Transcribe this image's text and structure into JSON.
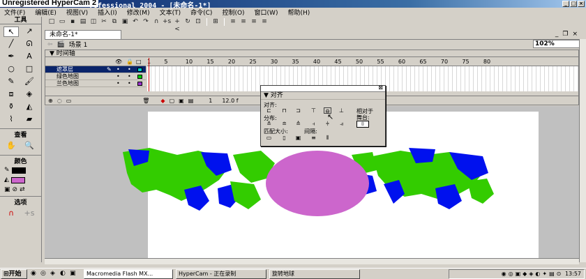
{
  "window": {
    "watermark": "Unregistered HyperCam 2",
    "title": "rofessional 2004 - [未命名-1*]"
  },
  "menu": [
    "文件(F)",
    "编辑(E)",
    "视图(V)",
    "插入(I)",
    "修改(M)",
    "文本(T)",
    "命令(C)",
    "控制(O)",
    "窗口(W)",
    "帮助(H)"
  ],
  "tools": {
    "title": "工具",
    "view_label": "查看",
    "colors_label": "颜色",
    "options_label": "选项",
    "stroke_color": "#000000",
    "fill_color": "#cc66cc"
  },
  "document": {
    "tab": "未命名-1*",
    "scene": "场景 1",
    "zoom": "102%"
  },
  "timeline": {
    "title": "时间轴",
    "layers": [
      {
        "name": "遮罩层",
        "color": "#00cccc",
        "selected": true
      },
      {
        "name": "绿色地图",
        "color": "#00cc00",
        "selected": false
      },
      {
        "name": "兰色地图",
        "color": "#9933cc",
        "selected": false
      }
    ],
    "ruler": [
      "1",
      "5",
      "10",
      "15",
      "20",
      "25",
      "30",
      "35",
      "40",
      "45",
      "50",
      "55",
      "60",
      "65",
      "70",
      "75",
      "80"
    ],
    "current_frame": "1",
    "fps": "12.0 f"
  },
  "align_panel": {
    "title": "对齐",
    "align_label": "对齐:",
    "distribute_label": "分布:",
    "match_size_label": "匹配大小:",
    "spacing_label": "间隔:",
    "relative_label": "相对于",
    "stage_label": "舞台:"
  },
  "stage": {
    "circle_color": "#cc66cc",
    "map_green": "#33cc00",
    "map_blue": "#0011ee"
  },
  "taskbar": {
    "start": "开始",
    "tasks": [
      "Macromedia Flash MX...",
      "HyperCam - 正在录制",
      "旋转地球"
    ],
    "clock": "13:57"
  }
}
